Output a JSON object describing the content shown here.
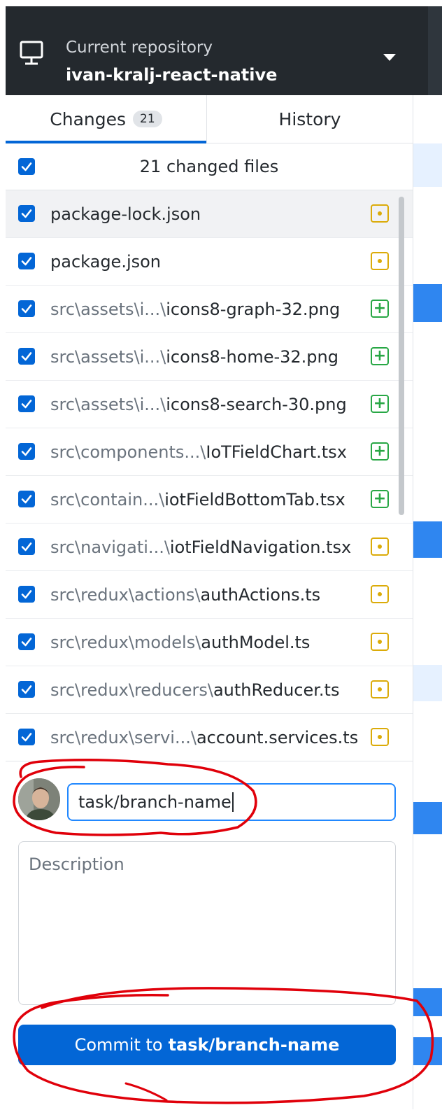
{
  "repo": {
    "label": "Current repository",
    "name": "ivan-kralj-react-native"
  },
  "tabs": {
    "changes_label": "Changes",
    "changes_count": "21",
    "history_label": "History"
  },
  "changes_header": {
    "text": "21 changed files"
  },
  "files": [
    {
      "dir": "",
      "name": "package-lock.json",
      "status": "modified",
      "checked": true
    },
    {
      "dir": "",
      "name": "package.json",
      "status": "modified",
      "checked": true
    },
    {
      "dir": "src\\assets\\i...\\",
      "name": "icons8-graph-32.png",
      "status": "added",
      "checked": true
    },
    {
      "dir": "src\\assets\\i...\\",
      "name": "icons8-home-32.png",
      "status": "added",
      "checked": true
    },
    {
      "dir": "src\\assets\\i...\\",
      "name": "icons8-search-30.png",
      "status": "added",
      "checked": true
    },
    {
      "dir": "src\\components...\\",
      "name": "IoTFieldChart.tsx",
      "status": "added",
      "checked": true
    },
    {
      "dir": "src\\contain...\\",
      "name": "iotFieldBottomTab.tsx",
      "status": "added",
      "checked": true
    },
    {
      "dir": "src\\navigati...\\",
      "name": "iotFieldNavigation.tsx",
      "status": "modified",
      "checked": true
    },
    {
      "dir": "src\\redux\\actions\\",
      "name": "authActions.ts",
      "status": "modified",
      "checked": true
    },
    {
      "dir": "src\\redux\\models\\",
      "name": "authModel.ts",
      "status": "modified",
      "checked": true
    },
    {
      "dir": "src\\redux\\reducers\\",
      "name": "authReducer.ts",
      "status": "modified",
      "checked": true
    },
    {
      "dir": "src\\redux\\servi...\\",
      "name": "account.services.ts",
      "status": "modified",
      "checked": true
    }
  ],
  "commit": {
    "summary_value": "task/branch-name",
    "description_placeholder": "Description",
    "button_prefix": "Commit to",
    "button_branch": "task/branch-name"
  },
  "colors": {
    "accent": "#0366d6",
    "modified": "#dbab09",
    "added": "#28a745",
    "annotation": "#e0000a"
  }
}
